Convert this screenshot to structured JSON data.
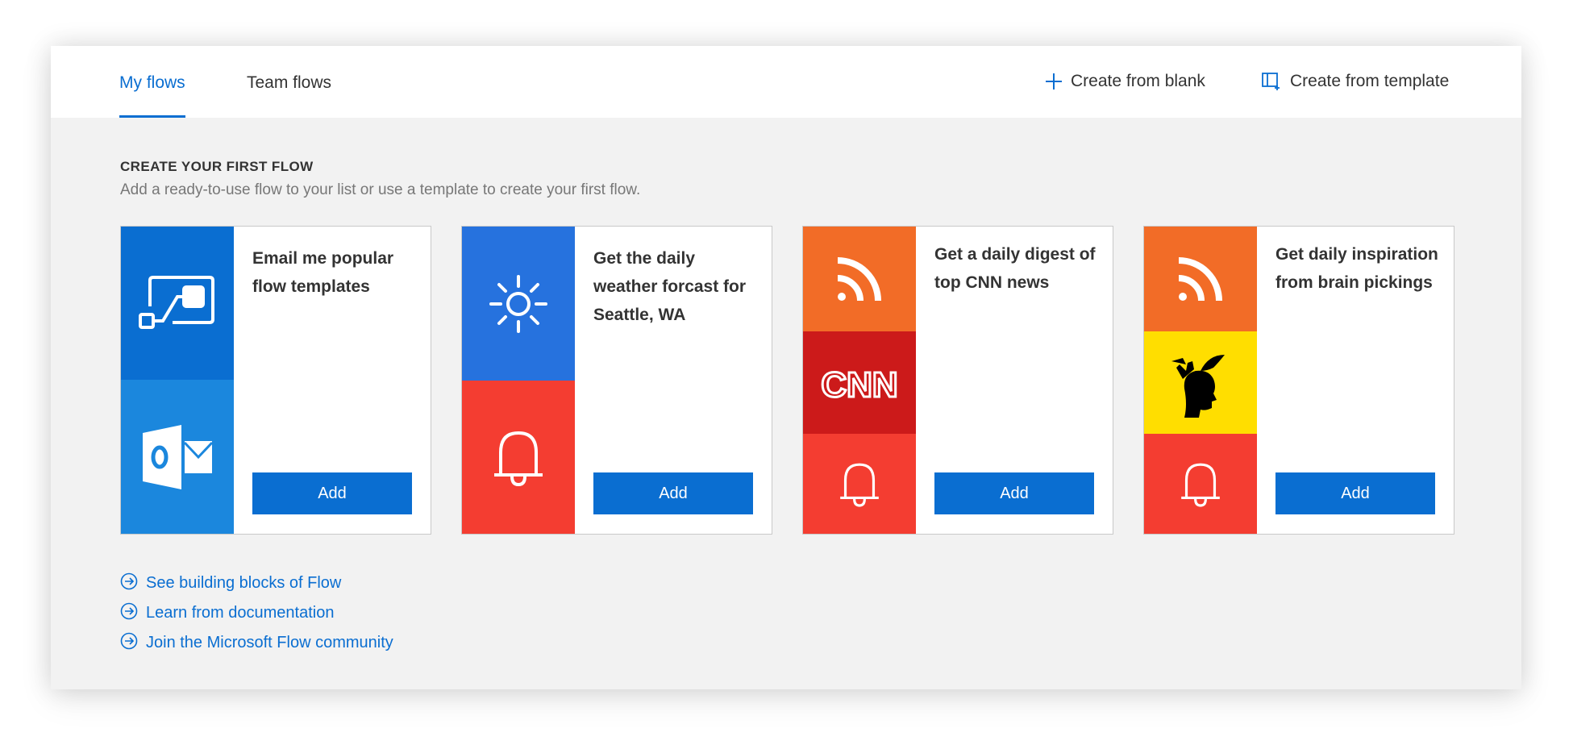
{
  "tabs": [
    {
      "label": "My flows",
      "active": true
    },
    {
      "label": "Team flows",
      "active": false
    }
  ],
  "actions": {
    "create_blank": "Create from blank",
    "create_template": "Create from template"
  },
  "section": {
    "title": "CREATE YOUR FIRST FLOW",
    "subtitle": "Add a ready-to-use flow to your list or use a template to create your first flow."
  },
  "cards": [
    {
      "title": "Email me popular flow templates",
      "button": "Add",
      "icons": [
        {
          "name": "flow-icon",
          "color": "#0a6ed1"
        },
        {
          "name": "outlook-icon",
          "color": "#1b87dd"
        }
      ]
    },
    {
      "title": "Get the daily weather forcast for Seattle, WA",
      "button": "Add",
      "icons": [
        {
          "name": "weather-sun-icon",
          "color": "#2672de"
        },
        {
          "name": "notification-bell-icon",
          "color": "#f43d31"
        }
      ]
    },
    {
      "title": "Get a daily digest of top CNN news",
      "button": "Add",
      "icons": [
        {
          "name": "rss-icon",
          "color": "#f26c27"
        },
        {
          "name": "cnn-logo-icon",
          "color": "#cc1a1a",
          "logo_text": "CNN"
        },
        {
          "name": "notification-bell-icon",
          "color": "#f43d31"
        }
      ]
    },
    {
      "title": "Get daily inspiration from brain pickings",
      "button": "Add",
      "icons": [
        {
          "name": "rss-icon",
          "color": "#f26c27"
        },
        {
          "name": "brain-pickings-logo-icon",
          "color": "#ffde00"
        },
        {
          "name": "notification-bell-icon",
          "color": "#f43d31"
        }
      ]
    }
  ],
  "links": [
    "See building blocks of Flow",
    "Learn from documentation",
    "Join the Microsoft Flow community"
  ],
  "colors": {
    "accent": "#0a6ed1",
    "background": "#f2f2f2",
    "text": "#333333"
  }
}
